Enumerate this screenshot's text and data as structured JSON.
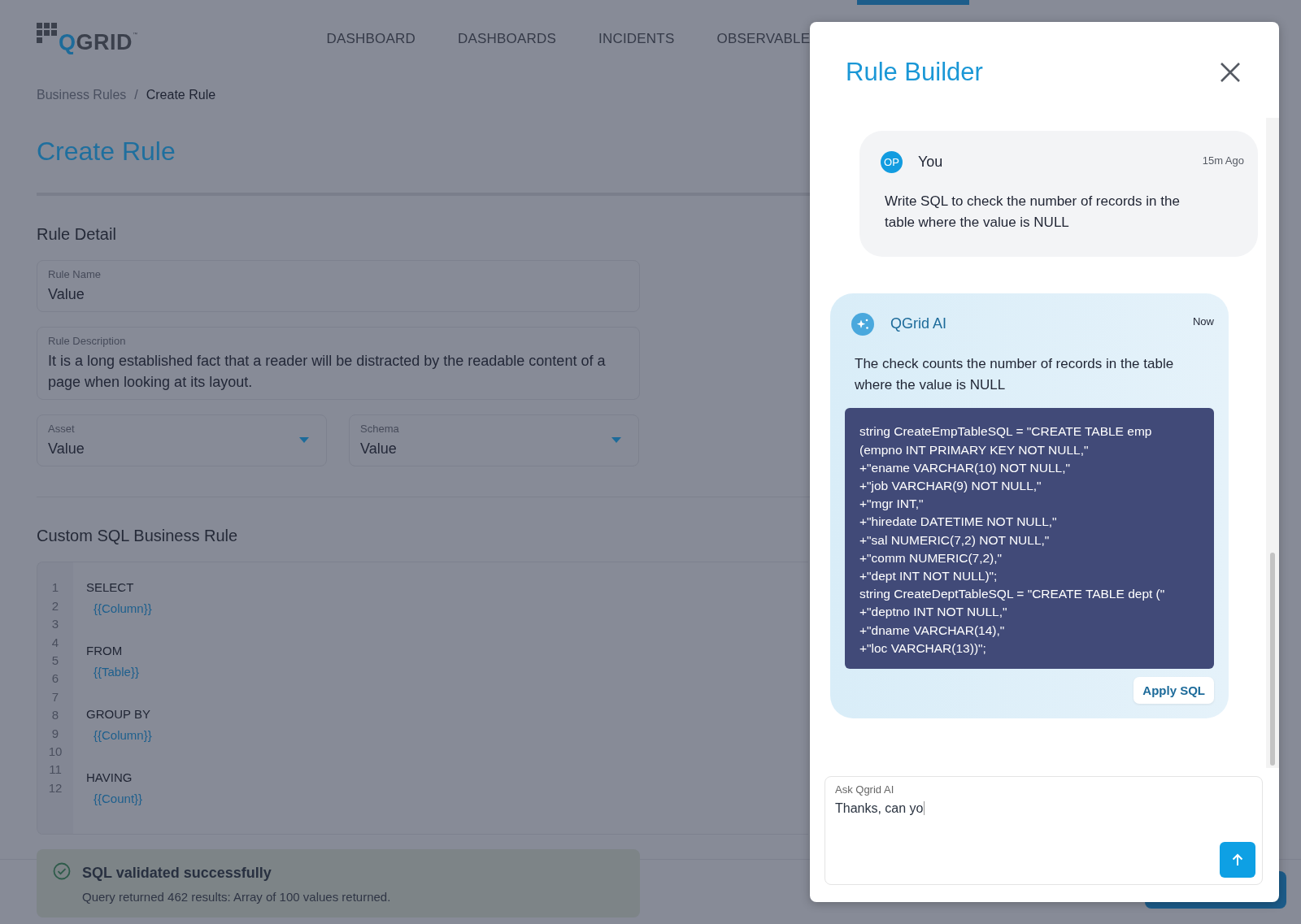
{
  "logo": {
    "text": "QGRID",
    "mark": "™"
  },
  "nav": [
    {
      "label": "DASHBOARD"
    },
    {
      "label": "DASHBOARDS"
    },
    {
      "label": "INCIDENTS"
    },
    {
      "label": "OBSERVABLE"
    }
  ],
  "breadcrumb": {
    "separator": "/",
    "items": [
      {
        "label": "Business Rules",
        "current": false
      },
      {
        "label": "Create Rule",
        "current": true
      }
    ]
  },
  "page_title": "Create Rule",
  "rule_detail": {
    "title": "Rule Detail",
    "fields": [
      {
        "kind": "text",
        "label": "Rule Name",
        "value": "Value"
      },
      {
        "kind": "textarea",
        "label": "Rule Description",
        "value": "It is a long established fact that a reader will be distracted by the readable content of a page when looking at its layout."
      },
      {
        "kind": "select",
        "label": "Asset",
        "value": "Value"
      },
      {
        "kind": "select",
        "label": "Schema",
        "value": "Value"
      }
    ]
  },
  "sql_rule": {
    "title": "Custom SQL Business Rule",
    "line_numbers": [
      "1",
      "2",
      "3",
      "4",
      "5",
      "6",
      "7",
      "8",
      "9",
      "10",
      "11",
      "12"
    ],
    "lines": [
      {
        "kind": "keyword",
        "text": "SELECT"
      },
      {
        "kind": "placeholder",
        "text": "{{Column}}"
      },
      {
        "kind": "blank"
      },
      {
        "kind": "keyword",
        "text": "FROM"
      },
      {
        "kind": "placeholder",
        "text": "{{Table}}"
      },
      {
        "kind": "blank"
      },
      {
        "kind": "keyword",
        "text": "GROUP BY"
      },
      {
        "kind": "placeholder",
        "text": "{{Column}}"
      },
      {
        "kind": "blank"
      },
      {
        "kind": "keyword",
        "text": "HAVING"
      },
      {
        "kind": "placeholder",
        "text": "{{Count}}"
      }
    ]
  },
  "validation": {
    "title": "SQL validated successfully",
    "message": "Query returned 462 results: Array of 100 values returned."
  },
  "rule_builder": {
    "title": "Rule Builder",
    "messages": [
      {
        "kind": "user",
        "avatar": "OP",
        "author": "You",
        "time": "15m Ago",
        "text": "Write SQL to check the number of records in the table where the value is NULL"
      },
      {
        "kind": "ai",
        "author": "QGrid AI",
        "time": "Now",
        "text": "The check counts the number of records in the table where the value is NULL",
        "code": [
          "string CreateEmpTableSQL = \"CREATE TABLE emp",
          "(empno INT PRIMARY KEY NOT NULL,\"",
          "+\"ename VARCHAR(10) NOT NULL,\"",
          "+\"job VARCHAR(9) NOT NULL,\"",
          "+\"mgr INT,\"",
          "+\"hiredate DATETIME NOT NULL,\"",
          "+\"sal NUMERIC(7,2) NOT NULL,\"",
          "+\"comm NUMERIC(7,2),\"",
          "+\"dept INT NOT NULL)\";",
          "string CreateDeptTableSQL = \"CREATE TABLE dept (\"",
          "+\"deptno INT NOT NULL,\"",
          "+\"dname VARCHAR(14),\"",
          "+\"loc VARCHAR(13))\";"
        ],
        "action": "Apply SQL"
      }
    ],
    "composer": {
      "label": "Ask Qgrid AI",
      "value": "Thanks, can yo"
    }
  }
}
